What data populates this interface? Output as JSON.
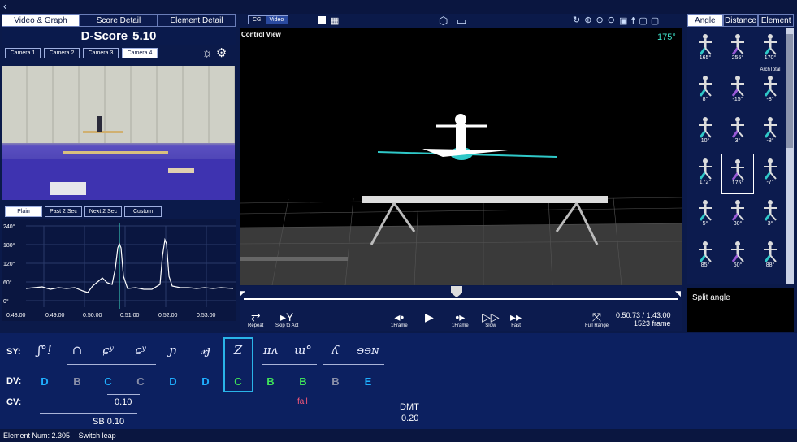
{
  "topbar": {
    "back_icon": "back-arrow-icon"
  },
  "left": {
    "tabs": [
      "Video & Graph",
      "Score Detail",
      "Element Detail"
    ],
    "dscore_label": "D-Score",
    "dscore_value": "5.10",
    "cameras": [
      "Camera 1",
      "Camera 2",
      "Camera 3",
      "Camera 4"
    ],
    "graph_tabs": [
      "Plain",
      "Past 2 Sec",
      "Next 2 Sec",
      "Custom"
    ],
    "graph": {
      "y_ticks": [
        "240°",
        "180°",
        "120°",
        "60°",
        "0°"
      ],
      "x_ticks": [
        "0:48.00",
        "0:49.00",
        "0:50.00",
        "0:51.00",
        "0:52.00",
        "0:53.00"
      ]
    }
  },
  "center": {
    "toggle": [
      "CG",
      "Video"
    ],
    "view_label": "Control View",
    "view_angle": "175°",
    "controls": {
      "repeat": "Repeat",
      "skip": "Skip to Act",
      "prev": "1Frame",
      "next": "1Frame",
      "slow": "Slow",
      "fast": "Fast",
      "full": "Full Range"
    },
    "time": "0.50.73 / 1.43.00",
    "frame": "1523 frame"
  },
  "right": {
    "tabs": [
      "Angle",
      "Distance",
      "Element"
    ],
    "angles": [
      "165°",
      "255°",
      "170°",
      "8°",
      "-15°",
      "-8°",
      "10°",
      "3°",
      "-8°",
      "172°",
      "175°",
      "-7°",
      "5°",
      "30°",
      "3°",
      "85°",
      "60°",
      "88°"
    ],
    "arch_label": "ArchTotal",
    "selected_name": "Split angle"
  },
  "table": {
    "labels": [
      "SY:",
      "DV:",
      "CV:"
    ],
    "symbols": [
      "ʃ°!",
      "∩",
      "ɕʸ",
      "ɕʸ",
      "ɲ",
      "𝓍ɟ",
      "Z",
      "ɪɪʌ",
      "ɯ°",
      "ʎ",
      "ɘɘɴ"
    ],
    "dv": [
      "D",
      "B",
      "C",
      "C",
      "D",
      "D",
      "C",
      "B",
      "B",
      "B",
      "E"
    ],
    "dv_colors": [
      "#1fb0ff",
      "#8a8fa8",
      "#1fb0ff",
      "#8a8fa8",
      "#1fb0ff",
      "#1fb0ff",
      "#3ee05a",
      "#3ee05a",
      "#3ee05a",
      "#8a8fa8",
      "#1fb0ff"
    ],
    "cv_value": "0.10",
    "fall": "fall",
    "dmt_label": "DMT",
    "dmt_value": "0.20",
    "sb_label": "SB 0.10"
  },
  "status": {
    "element_num": "Element Num: 2.305",
    "element_name": "Switch leap"
  }
}
